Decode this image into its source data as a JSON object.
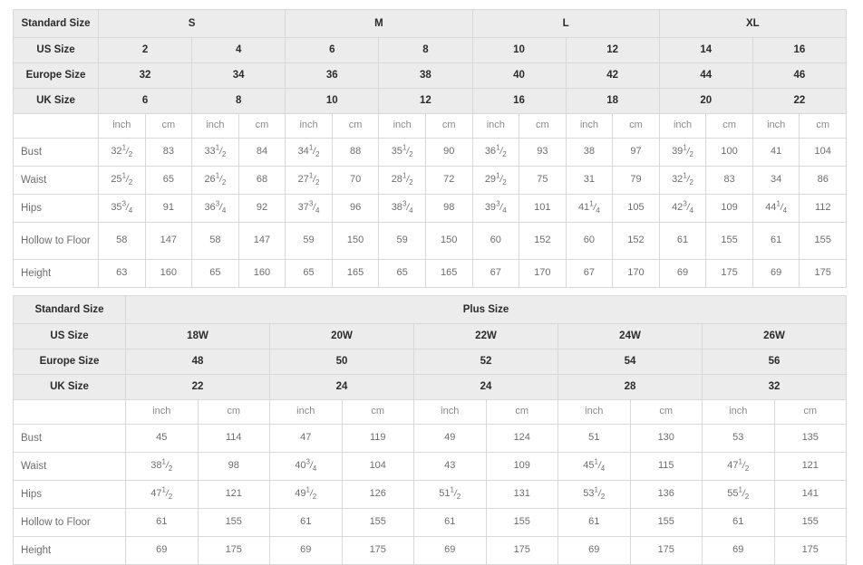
{
  "standard_table": {
    "corner_label": "Standard Size",
    "size_groups": [
      {
        "label": "S",
        "span": 4
      },
      {
        "label": "M",
        "span": 4
      },
      {
        "label": "L",
        "span": 4
      },
      {
        "label": "XL",
        "span": 4
      }
    ],
    "rows": [
      {
        "label": "US Size",
        "values": [
          "2",
          "4",
          "6",
          "8",
          "10",
          "12",
          "14",
          "16"
        ]
      },
      {
        "label": "Europe Size",
        "values": [
          "32",
          "34",
          "36",
          "38",
          "40",
          "42",
          "44",
          "46"
        ]
      },
      {
        "label": "UK Size",
        "values": [
          "6",
          "8",
          "10",
          "12",
          "16",
          "18",
          "20",
          "22"
        ]
      }
    ],
    "unit_row": {
      "label": "",
      "units": [
        "inch",
        "cm",
        "inch",
        "cm",
        "inch",
        "cm",
        "inch",
        "cm",
        "inch",
        "cm",
        "inch",
        "cm",
        "inch",
        "cm",
        "inch",
        "cm"
      ]
    },
    "measurements": [
      {
        "label": "Bust",
        "values": [
          {
            "w": "32",
            "n": "1",
            "d": "2"
          },
          {
            "w": "83"
          },
          {
            "w": "33",
            "n": "1",
            "d": "2"
          },
          {
            "w": "84"
          },
          {
            "w": "34",
            "n": "1",
            "d": "2"
          },
          {
            "w": "88"
          },
          {
            "w": "35",
            "n": "1",
            "d": "2"
          },
          {
            "w": "90"
          },
          {
            "w": "36",
            "n": "1",
            "d": "2"
          },
          {
            "w": "93"
          },
          {
            "w": "38"
          },
          {
            "w": "97"
          },
          {
            "w": "39",
            "n": "1",
            "d": "2"
          },
          {
            "w": "100"
          },
          {
            "w": "41"
          },
          {
            "w": "104"
          }
        ]
      },
      {
        "label": "Waist",
        "values": [
          {
            "w": "25",
            "n": "1",
            "d": "2"
          },
          {
            "w": "65"
          },
          {
            "w": "26",
            "n": "1",
            "d": "2"
          },
          {
            "w": "68"
          },
          {
            "w": "27",
            "n": "1",
            "d": "2"
          },
          {
            "w": "70"
          },
          {
            "w": "28",
            "n": "1",
            "d": "2"
          },
          {
            "w": "72"
          },
          {
            "w": "29",
            "n": "1",
            "d": "2"
          },
          {
            "w": "75"
          },
          {
            "w": "31"
          },
          {
            "w": "79"
          },
          {
            "w": "32",
            "n": "1",
            "d": "2"
          },
          {
            "w": "83"
          },
          {
            "w": "34"
          },
          {
            "w": "86"
          }
        ]
      },
      {
        "label": "Hips",
        "values": [
          {
            "w": "35",
            "n": "3",
            "d": "4"
          },
          {
            "w": "91"
          },
          {
            "w": "36",
            "n": "3",
            "d": "4"
          },
          {
            "w": "92"
          },
          {
            "w": "37",
            "n": "3",
            "d": "4"
          },
          {
            "w": "96"
          },
          {
            "w": "38",
            "n": "3",
            "d": "4"
          },
          {
            "w": "98"
          },
          {
            "w": "39",
            "n": "3",
            "d": "4"
          },
          {
            "w": "101"
          },
          {
            "w": "41",
            "n": "1",
            "d": "4"
          },
          {
            "w": "105"
          },
          {
            "w": "42",
            "n": "3",
            "d": "4"
          },
          {
            "w": "109"
          },
          {
            "w": "44",
            "n": "1",
            "d": "4"
          },
          {
            "w": "112"
          }
        ]
      },
      {
        "label": "Hollow to Floor",
        "values": [
          {
            "w": "58"
          },
          {
            "w": "147"
          },
          {
            "w": "58"
          },
          {
            "w": "147"
          },
          {
            "w": "59"
          },
          {
            "w": "150"
          },
          {
            "w": "59"
          },
          {
            "w": "150"
          },
          {
            "w": "60"
          },
          {
            "w": "152"
          },
          {
            "w": "60"
          },
          {
            "w": "152"
          },
          {
            "w": "61"
          },
          {
            "w": "155"
          },
          {
            "w": "61"
          },
          {
            "w": "155"
          }
        ]
      },
      {
        "label": "Height",
        "values": [
          {
            "w": "63"
          },
          {
            "w": "160"
          },
          {
            "w": "65"
          },
          {
            "w": "160"
          },
          {
            "w": "65"
          },
          {
            "w": "165"
          },
          {
            "w": "65"
          },
          {
            "w": "165"
          },
          {
            "w": "67"
          },
          {
            "w": "170"
          },
          {
            "w": "67"
          },
          {
            "w": "170"
          },
          {
            "w": "69"
          },
          {
            "w": "175"
          },
          {
            "w": "69"
          },
          {
            "w": "175"
          }
        ]
      }
    ]
  },
  "plus_table": {
    "corner_label": "Standard Size",
    "section_label": "Plus Size",
    "rows": [
      {
        "label": "US Size",
        "values": [
          "18W",
          "20W",
          "22W",
          "24W",
          "26W"
        ]
      },
      {
        "label": "Europe Size",
        "values": [
          "48",
          "50",
          "52",
          "54",
          "56"
        ]
      },
      {
        "label": "UK Size",
        "values": [
          "22",
          "24",
          "24",
          "28",
          "32"
        ]
      }
    ],
    "unit_row": {
      "label": "",
      "units": [
        "inch",
        "cm",
        "inch",
        "cm",
        "inch",
        "cm",
        "inch",
        "cm",
        "inch",
        "cm"
      ]
    },
    "measurements": [
      {
        "label": "Bust",
        "values": [
          {
            "w": "45"
          },
          {
            "w": "114"
          },
          {
            "w": "47"
          },
          {
            "w": "119"
          },
          {
            "w": "49"
          },
          {
            "w": "124"
          },
          {
            "w": "51"
          },
          {
            "w": "130"
          },
          {
            "w": "53"
          },
          {
            "w": "135"
          }
        ]
      },
      {
        "label": "Waist",
        "values": [
          {
            "w": "38",
            "n": "1",
            "d": "2"
          },
          {
            "w": "98"
          },
          {
            "w": "40",
            "n": "3",
            "d": "4"
          },
          {
            "w": "104"
          },
          {
            "w": "43"
          },
          {
            "w": "109"
          },
          {
            "w": "45",
            "n": "1",
            "d": "4"
          },
          {
            "w": "115"
          },
          {
            "w": "47",
            "n": "1",
            "d": "2"
          },
          {
            "w": "121"
          }
        ]
      },
      {
        "label": "Hips",
        "values": [
          {
            "w": "47",
            "n": "1",
            "d": "2"
          },
          {
            "w": "121"
          },
          {
            "w": "49",
            "n": "1",
            "d": "2"
          },
          {
            "w": "126"
          },
          {
            "w": "51",
            "n": "1",
            "d": "2"
          },
          {
            "w": "131"
          },
          {
            "w": "53",
            "n": "1",
            "d": "2"
          },
          {
            "w": "136"
          },
          {
            "w": "55",
            "n": "1",
            "d": "2"
          },
          {
            "w": "141"
          }
        ]
      },
      {
        "label": "Hollow to Floor",
        "values": [
          {
            "w": "61"
          },
          {
            "w": "155"
          },
          {
            "w": "61"
          },
          {
            "w": "155"
          },
          {
            "w": "61"
          },
          {
            "w": "155"
          },
          {
            "w": "61"
          },
          {
            "w": "155"
          },
          {
            "w": "61"
          },
          {
            "w": "155"
          }
        ]
      },
      {
        "label": "Height",
        "values": [
          {
            "w": "69"
          },
          {
            "w": "175"
          },
          {
            "w": "69"
          },
          {
            "w": "175"
          },
          {
            "w": "69"
          },
          {
            "w": "175"
          },
          {
            "w": "69"
          },
          {
            "w": "175"
          },
          {
            "w": "69"
          },
          {
            "w": "175"
          }
        ]
      }
    ]
  },
  "colors": {
    "header_fill": "#ececec",
    "border": "#d8d8d8",
    "header_text": "#2b2b2b",
    "body_text": "#6d6d6d"
  }
}
